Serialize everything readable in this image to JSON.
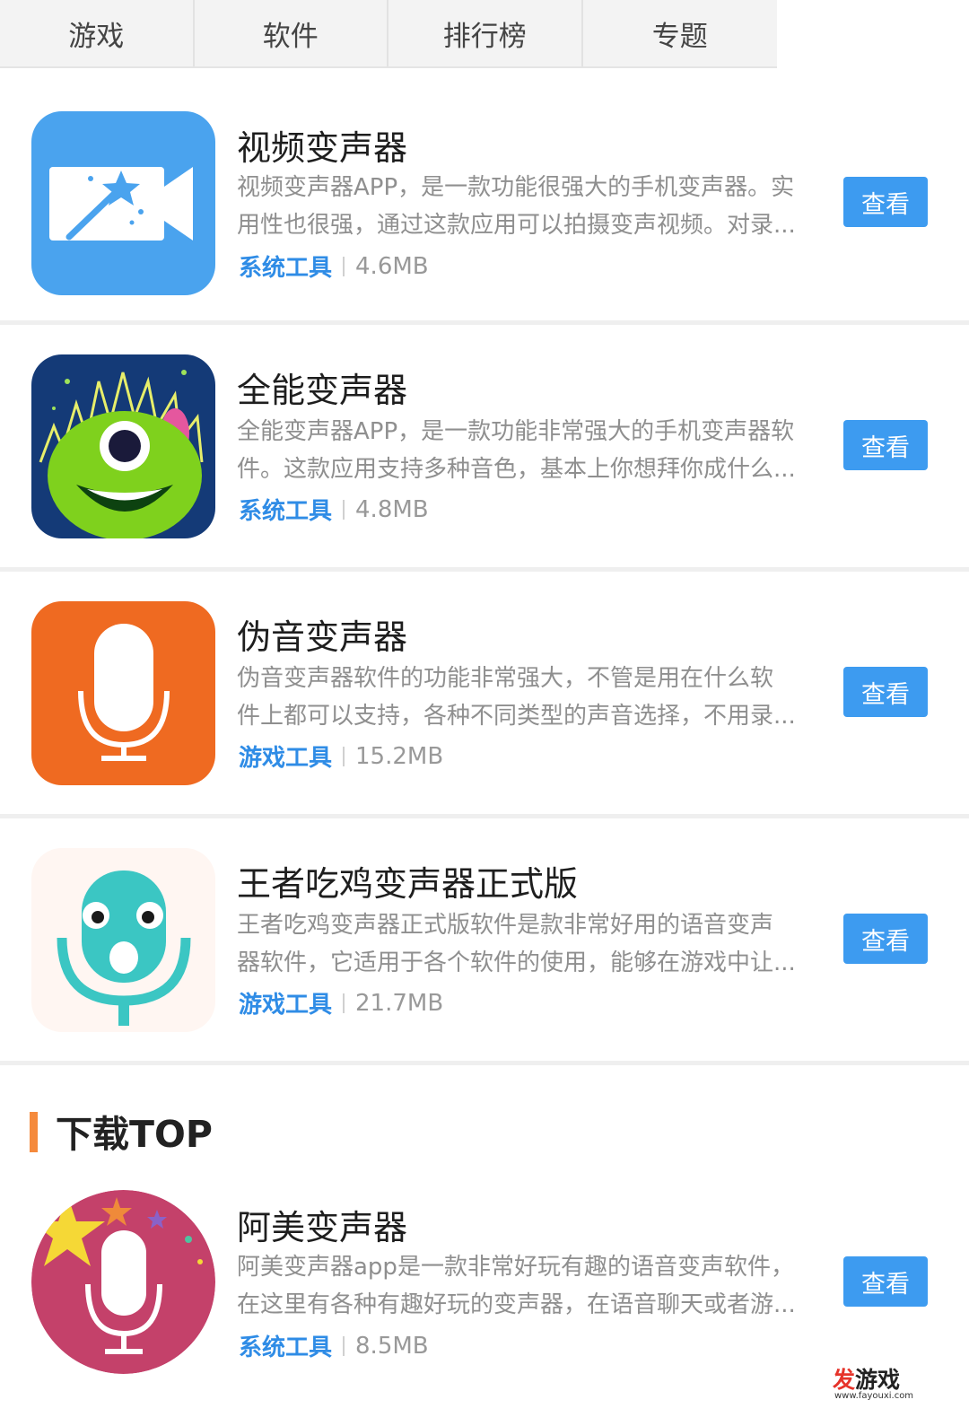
{
  "tabs": [
    "游戏",
    "软件",
    "排行榜",
    "专题"
  ],
  "apps": [
    {
      "title": "视频变声器",
      "desc_line1": "视频变声器APP，是一款功能很强大的手机变声器。实",
      "desc_line2": "用性也很强，通过这款应用可以拍摄变声视频。对录...",
      "category": "系统工具",
      "size": "4.6MB",
      "button": "查看",
      "icon": "video-camera-magic-icon"
    },
    {
      "title": "全能变声器",
      "desc_line1": "全能变声器APP，是一款功能非常强大的手机变声器软",
      "desc_line2": "件。这款应用支持多种音色，基本上你想拜你成什么...",
      "category": "系统工具",
      "size": "4.8MB",
      "button": "查看",
      "icon": "green-monster-icon"
    },
    {
      "title": "伪音变声器",
      "desc_line1": "伪音变声器软件的功能非常强大，不管是用在什么软",
      "desc_line2": "件上都可以支持，各种不同类型的声音选择，不用录...",
      "category": "游戏工具",
      "size": "15.2MB",
      "button": "查看",
      "icon": "microphone-icon"
    },
    {
      "title": "王者吃鸡变声器正式版",
      "desc_line1": "王者吃鸡变声器正式版软件是款非常好用的语音变声",
      "desc_line2": "器软件，它适用于各个软件的使用，能够在游戏中让...",
      "category": "游戏工具",
      "size": "21.7MB",
      "button": "查看",
      "icon": "cartoon-microphone-face-icon"
    }
  ],
  "section_title": "下载TOP",
  "top_apps": [
    {
      "title": "阿美变声器",
      "desc_line1": "阿美变声器app是一款非常好玩有趣的语音变声软件，",
      "desc_line2": "在这里有各种有趣好玩的变声器，在语音聊天或者游...",
      "category": "系统工具",
      "size": "8.5MB",
      "button": "查看",
      "icon": "star-microphone-icon"
    }
  ],
  "watermark": {
    "fa": "发",
    "rest": "游戏",
    "url": "www.fayouxi.com"
  },
  "colors": {
    "accent": "#3d9bf0",
    "category": "#2f8ce6",
    "section_bar": "#f58a3c"
  }
}
